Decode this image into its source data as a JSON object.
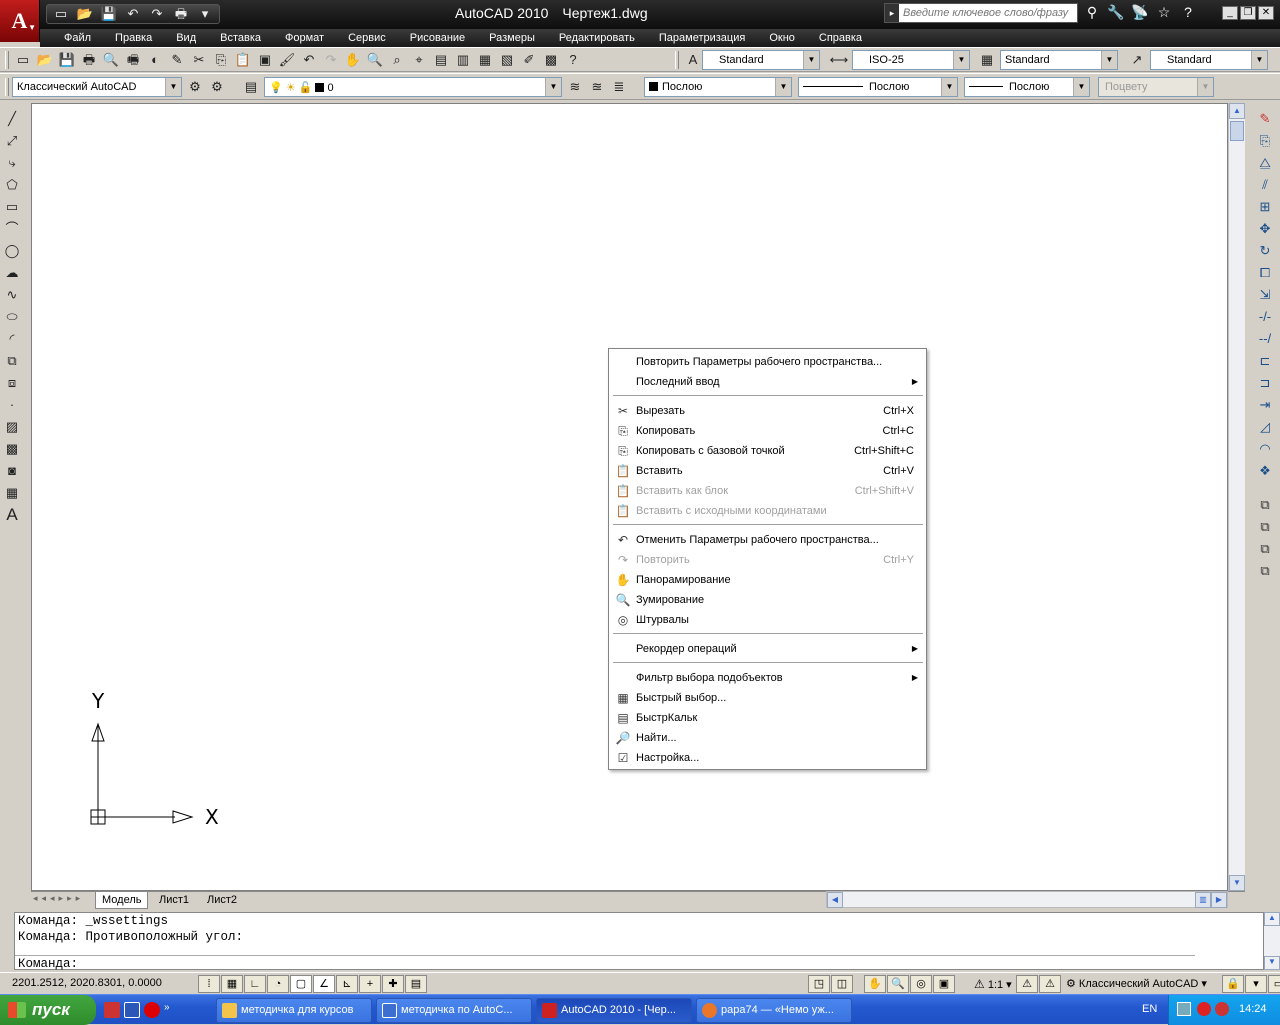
{
  "app": {
    "title": "AutoCAD 2010",
    "document": "Чертеж1.dwg",
    "logo_letter": "A"
  },
  "search": {
    "placeholder": "Введите ключевое слово/фразу"
  },
  "menu": [
    "Файл",
    "Правка",
    "Вид",
    "Вставка",
    "Формат",
    "Сервис",
    "Рисование",
    "Размеры",
    "Редактировать",
    "Параметризация",
    "Окно",
    "Справка"
  ],
  "styles": {
    "text_style": "Standard",
    "dim_style": "ISO-25",
    "table_style": "Standard",
    "mleader_style": "Standard"
  },
  "workspace": {
    "name": "Классический AutoCAD"
  },
  "layer": {
    "current": "0"
  },
  "properties": {
    "color": "Послою",
    "linetype": "Послою",
    "lineweight": "Послою",
    "plotstyle": "Поцвету"
  },
  "tabs": [
    "Модель",
    "Лист1",
    "Лист2"
  ],
  "command": {
    "lines": [
      "Команда:  _wssettings",
      "Команда: Противоположный угол:"
    ],
    "prompt": "Команда:"
  },
  "status": {
    "coords": "2201.2512, 2020.8301, 0.0000",
    "scale": "1:1",
    "workspace": "Классический AutoCAD"
  },
  "context_menu": [
    {
      "label": "Повторить Параметры рабочего пространства...",
      "shortcut": "",
      "icon": "",
      "disabled": false,
      "submenu": false
    },
    {
      "label": "Последний ввод",
      "shortcut": "",
      "icon": "",
      "disabled": false,
      "submenu": true
    },
    {
      "label": "Вырезать",
      "shortcut": "Ctrl+X",
      "icon": "✂",
      "disabled": false,
      "submenu": false
    },
    {
      "label": "Копировать",
      "shortcut": "Ctrl+C",
      "icon": "⎘",
      "disabled": false,
      "submenu": false
    },
    {
      "label": "Копировать с базовой точкой",
      "shortcut": "Ctrl+Shift+C",
      "icon": "⎘",
      "disabled": false,
      "submenu": false
    },
    {
      "label": "Вставить",
      "shortcut": "Ctrl+V",
      "icon": "📋",
      "disabled": false,
      "submenu": false
    },
    {
      "label": "Вставить как блок",
      "shortcut": "Ctrl+Shift+V",
      "icon": "📋",
      "disabled": true,
      "submenu": false
    },
    {
      "label": "Вставить с исходными координатами",
      "shortcut": "",
      "icon": "📋",
      "disabled": true,
      "submenu": false
    },
    {
      "label": "Отменить Параметры рабочего пространства...",
      "shortcut": "",
      "icon": "↶",
      "disabled": false,
      "submenu": false
    },
    {
      "label": "Повторить",
      "shortcut": "Ctrl+Y",
      "icon": "↷",
      "disabled": true,
      "submenu": false
    },
    {
      "label": "Панорамирование",
      "shortcut": "",
      "icon": "✋",
      "disabled": false,
      "submenu": false
    },
    {
      "label": "Зумирование",
      "shortcut": "",
      "icon": "🔍",
      "disabled": false,
      "submenu": false
    },
    {
      "label": "Штурвалы",
      "shortcut": "",
      "icon": "◎",
      "disabled": false,
      "submenu": false
    },
    {
      "label": "Рекордер операций",
      "shortcut": "",
      "icon": "",
      "disabled": false,
      "submenu": true
    },
    {
      "label": "Фильтр выбора подобъектов",
      "shortcut": "",
      "icon": "",
      "disabled": false,
      "submenu": true
    },
    {
      "label": "Быстрый выбор...",
      "shortcut": "",
      "icon": "▦",
      "disabled": false,
      "submenu": false
    },
    {
      "label": "БыстрКальк",
      "shortcut": "",
      "icon": "▤",
      "disabled": false,
      "submenu": false
    },
    {
      "label": "Найти...",
      "shortcut": "",
      "icon": "🔎",
      "disabled": false,
      "submenu": false
    },
    {
      "label": "Настройка...",
      "shortcut": "",
      "icon": "☑",
      "disabled": false,
      "submenu": false
    }
  ],
  "ucs": {
    "x_label": "X",
    "y_label": "Y"
  },
  "taskbar": {
    "start": "пуск",
    "buttons": [
      "методичка для курсов",
      "методичка по AutoC...",
      "AutoCAD 2010 - [Чер...",
      "papa74 — «Немо уж..."
    ],
    "lang": "EN",
    "time": "14:24"
  }
}
